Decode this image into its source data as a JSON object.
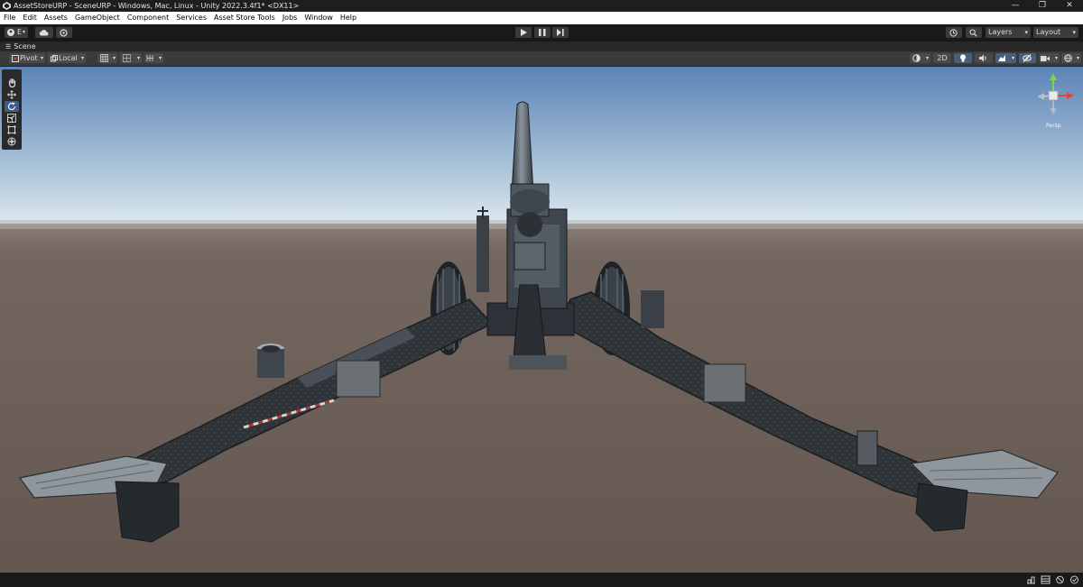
{
  "window": {
    "title": "AssetStoreURP - SceneURP - Windows, Mac, Linux - Unity 2022.3.4f1* <DX11>",
    "controls": [
      "—",
      "❐",
      "✕"
    ]
  },
  "menu": [
    "File",
    "Edit",
    "Assets",
    "GameObject",
    "Component",
    "Services",
    "Asset Store Tools",
    "Jobs",
    "Window",
    "Help"
  ],
  "toolbar": {
    "account_label": "E",
    "layers_label": "Layers",
    "layout_label": "Layout"
  },
  "scene_tab": {
    "label": "Scene"
  },
  "scene_toolbar": {
    "pivot_label": "Pivot",
    "local_label": "Local",
    "mode_2d_label": "2D"
  },
  "gizmo": {
    "projection": "Persp"
  },
  "colors": {
    "editor_dark": "#191919",
    "panel": "#282828",
    "sky_top": "#5f86b8",
    "horizon": "#d7e6ef",
    "ground": "#6a5e58",
    "accent": "#3e5e86"
  }
}
